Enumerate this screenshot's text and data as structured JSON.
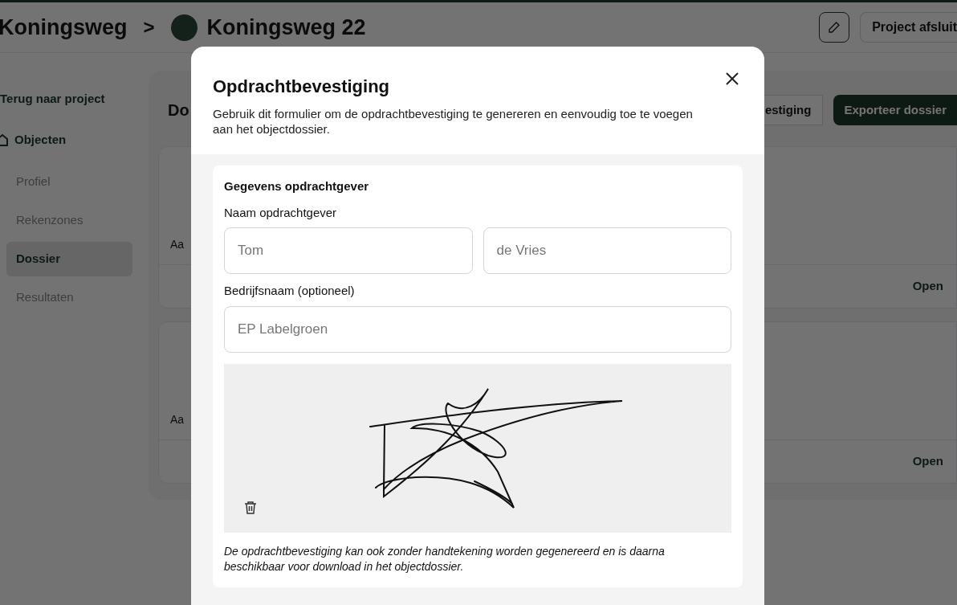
{
  "breadcrumb": {
    "parent": "Koningsweg",
    "separator": ">",
    "current": "Koningsweg 22"
  },
  "header_actions": {
    "close_project": "Project afsluit"
  },
  "sidebar": {
    "back": "Terug naar project",
    "section": "Objecten",
    "items": [
      {
        "label": "Profiel",
        "selected": false
      },
      {
        "label": "Rekenzones",
        "selected": false
      },
      {
        "label": "Dossier",
        "selected": true
      },
      {
        "label": "Resultaten",
        "selected": false
      }
    ]
  },
  "main": {
    "title": "Do",
    "actions": [
      {
        "label": "estiging",
        "kind": "secondary"
      },
      {
        "label": "Exporteer dossier",
        "kind": "primary"
      }
    ],
    "cards": [
      {
        "label": "Aa",
        "action": "Open"
      },
      {
        "label": "Aa",
        "action": "Open"
      }
    ]
  },
  "modal": {
    "title": "Opdrachtbevestiging",
    "description": "Gebruik dit formulier om de opdrachtbevestiging te genereren en eenvoudig toe te voegen aan het objectdossier.",
    "section_title": "Gegevens opdrachtgever",
    "fields": [
      {
        "label": "Naam opdrachtgever",
        "inputs": [
          {
            "placeholder": "Tom"
          },
          {
            "placeholder": "de Vries"
          }
        ]
      },
      {
        "label": "Bedrijfsnaam (optioneel)",
        "inputs": [
          {
            "placeholder": "EP Labelgroen"
          }
        ]
      }
    ],
    "note": "De opdrachtbevestiging kan ook zonder handtekening worden gegenereerd en is daarna beschikbaar voor download in het objectdossier."
  }
}
